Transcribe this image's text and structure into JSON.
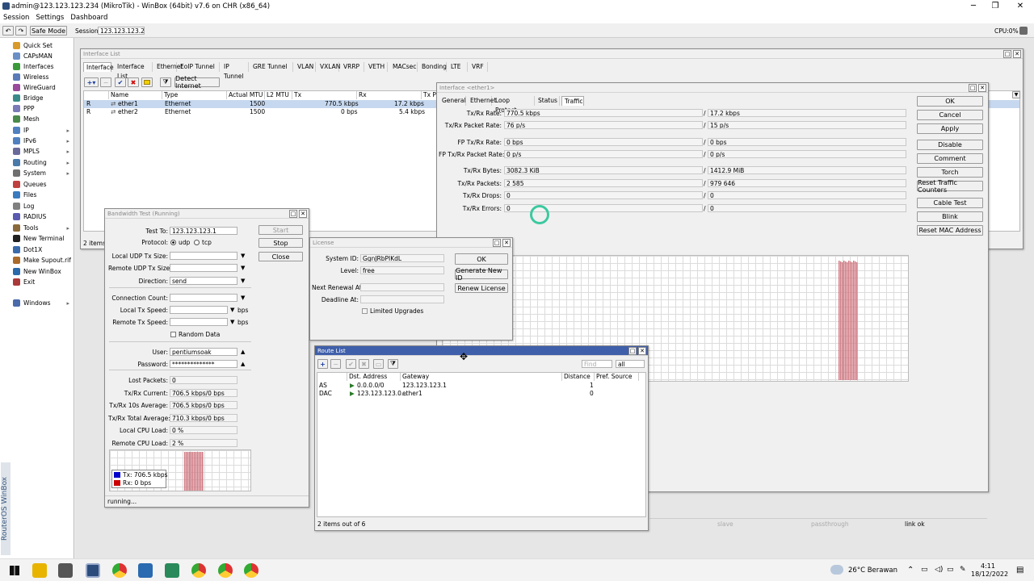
{
  "app": {
    "title": "admin@123.123.123.234 (MikroTik) - WinBox (64bit) v7.6 on CHR (x86_64)",
    "menu": [
      "Session",
      "Settings",
      "Dashboard"
    ],
    "toolbar": {
      "safe_mode": "Safe Mode",
      "session_label": "Session:",
      "session_value": "123.123.123.234",
      "cpu": "CPU:0%"
    },
    "side_brand": "RouterOS WinBox"
  },
  "sidebar": {
    "items": [
      {
        "label": "Quick Set",
        "color": "#d89a2a",
        "arrow": false
      },
      {
        "label": "CAPsMAN",
        "color": "#6a8fc7",
        "arrow": false
      },
      {
        "label": "Interfaces",
        "color": "#3a9a3a",
        "arrow": false
      },
      {
        "label": "Wireless",
        "color": "#5a7ab8",
        "arrow": false
      },
      {
        "label": "WireGuard",
        "color": "#9a4a9a",
        "arrow": false
      },
      {
        "label": "Bridge",
        "color": "#3a8a8a",
        "arrow": false
      },
      {
        "label": "PPP",
        "color": "#7a7ab8",
        "arrow": false
      },
      {
        "label": "Mesh",
        "color": "#4a8a4a",
        "arrow": false
      },
      {
        "label": "IP",
        "color": "#5080c0",
        "arrow": true
      },
      {
        "label": "IPv6",
        "color": "#5080c0",
        "arrow": true
      },
      {
        "label": "MPLS",
        "color": "#6a6a9a",
        "arrow": true
      },
      {
        "label": "Routing",
        "color": "#4a7aaa",
        "arrow": true
      },
      {
        "label": "System",
        "color": "#707070",
        "arrow": true
      },
      {
        "label": "Queues",
        "color": "#c04040",
        "arrow": false
      },
      {
        "label": "Files",
        "color": "#3a7ac0",
        "arrow": false
      },
      {
        "label": "Log",
        "color": "#808080",
        "arrow": false
      },
      {
        "label": "RADIUS",
        "color": "#5a5ab0",
        "arrow": false
      },
      {
        "label": "Tools",
        "color": "#8a6a3a",
        "arrow": true
      },
      {
        "label": "New Terminal",
        "color": "#202020",
        "arrow": false
      },
      {
        "label": "Dot1X",
        "color": "#3a6aaa",
        "arrow": false
      },
      {
        "label": "Make Supout.rif",
        "color": "#aa6a2a",
        "arrow": false
      },
      {
        "label": "New WinBox",
        "color": "#2a6aaa",
        "arrow": false
      },
      {
        "label": "Exit",
        "color": "#aa3a3a",
        "arrow": false
      },
      {
        "label": "Windows",
        "color": "#4a6aaa",
        "arrow": true
      }
    ]
  },
  "iface_list": {
    "title": "Interface List",
    "tabs": [
      "Interface",
      "Interface List",
      "Ethernet",
      "EoIP Tunnel",
      "IP Tunnel",
      "GRE Tunnel",
      "VLAN",
      "VXLAN",
      "VRRP",
      "VETH",
      "MACsec",
      "Bonding",
      "LTE",
      "VRF"
    ],
    "detect": "Detect Internet",
    "find": "Find",
    "columns": [
      "Name",
      "Type",
      "Actual MTU",
      "L2 MTU",
      "Tx",
      "Rx",
      "Tx Pa"
    ],
    "rows": [
      {
        "flag": "R",
        "name": "ether1",
        "type": "Ethernet",
        "mtu": "1500",
        "l2": "",
        "tx": "770.5 kbps",
        "rx": "17.2 kbps"
      },
      {
        "flag": "R",
        "name": "ether2",
        "type": "Ethernet",
        "mtu": "1500",
        "l2": "",
        "tx": "0 bps",
        "rx": "5.4 kbps"
      }
    ],
    "status": "2 items"
  },
  "ether1": {
    "title": "Interface <ether1>",
    "tabs": [
      "General",
      "Ethernet",
      "Loop Protect",
      "Status",
      "Traffic"
    ],
    "fields": [
      {
        "label": "Tx/Rx Rate:",
        "a": "770.5 kbps",
        "b": "17.2 kbps"
      },
      {
        "label": "Tx/Rx Packet Rate:",
        "a": "76 p/s",
        "b": "15 p/s"
      },
      {
        "label": "FP Tx/Rx Rate:",
        "a": "0 bps",
        "b": "0 bps"
      },
      {
        "label": "FP Tx/Rx Packet Rate:",
        "a": "0 p/s",
        "b": "0 p/s"
      },
      {
        "label": "Tx/Rx Bytes:",
        "a": "3082.3 KiB",
        "b": "1412.9 MiB"
      },
      {
        "label": "Tx/Rx Packets:",
        "a": "2 585",
        "b": "979 646"
      },
      {
        "label": "Tx/Rx Drops:",
        "a": "0",
        "b": "0"
      },
      {
        "label": "Tx/Rx Errors:",
        "a": "0",
        "b": "0"
      }
    ],
    "slash": "/",
    "buttons": [
      "OK",
      "Cancel",
      "Apply",
      "Disable",
      "Comment",
      "Torch",
      "Reset Traffic Counters",
      "Cable Test",
      "Blink",
      "Reset MAC Address"
    ],
    "status": [
      "slave",
      "passthrough",
      "link ok"
    ]
  },
  "btest": {
    "title": "Bandwidth Test (Running)",
    "fields": [
      {
        "label": "Test To:",
        "value": "123.123.123.1"
      },
      {
        "label": "Local UDP Tx Size:",
        "value": ""
      },
      {
        "label": "Remote UDP Tx Size:",
        "value": ""
      },
      {
        "label": "Direction:",
        "value": "send"
      },
      {
        "label": "Connection Count:",
        "value": ""
      },
      {
        "label": "Local Tx Speed:",
        "value": ""
      },
      {
        "label": "Remote Tx Speed:",
        "value": ""
      },
      {
        "label": "User:",
        "value": "pentiumsoak"
      },
      {
        "label": "Password:",
        "value": "**************"
      },
      {
        "label": "Lost Packets:",
        "value": "0"
      },
      {
        "label": "Tx/Rx Current:",
        "value": "706.5 kbps/0 bps"
      },
      {
        "label": "Tx/Rx 10s Average:",
        "value": "706.5 kbps/0 bps"
      },
      {
        "label": "Tx/Rx Total Average:",
        "value": "710.3 kbps/0 bps"
      },
      {
        "label": "Local CPU Load:",
        "value": "0 %"
      },
      {
        "label": "Remote CPU Load:",
        "value": "2 %"
      }
    ],
    "protocol_label": "Protocol:",
    "proto_udp": "udp",
    "proto_tcp": "tcp",
    "bps": "bps",
    "random_data": "Random Data",
    "buttons": [
      "Start",
      "Stop",
      "Close"
    ],
    "legend": {
      "tx": "Tx:  706.5 kbps",
      "rx": "Rx:  0 bps"
    },
    "status": "running..."
  },
  "license": {
    "title": "License",
    "fields": [
      {
        "label": "System ID:",
        "value": "GgnJRbPIKdL"
      },
      {
        "label": "Level:",
        "value": "free"
      },
      {
        "label": "Next Renewal At:",
        "value": ""
      },
      {
        "label": "Deadline At:",
        "value": ""
      }
    ],
    "limited": "Limited Upgrades",
    "buttons": [
      "OK",
      "Generate New ID",
      "Renew License"
    ]
  },
  "route": {
    "title": "Route List",
    "find": "Find",
    "filter": "all",
    "columns": [
      "Dst. Address",
      "Gateway",
      "Distance",
      "Pref. Source"
    ],
    "rows": [
      {
        "flag": "AS",
        "dst": "0.0.0.0/0",
        "gw": "123.123.123.1",
        "dist": "1"
      },
      {
        "flag": "DAC",
        "dst": "123.123.123.0...",
        "gw": "ether1",
        "dist": "0"
      }
    ],
    "status": "2 items out of 6"
  },
  "taskbar": {
    "weather": "26°C  Berawan",
    "time": "4:11",
    "date": "18/12/2022"
  },
  "colors": {
    "tx": "#0000cc",
    "rx": "#cc0000",
    "bar": "#d07b84",
    "active_title": "#3f5faa"
  }
}
